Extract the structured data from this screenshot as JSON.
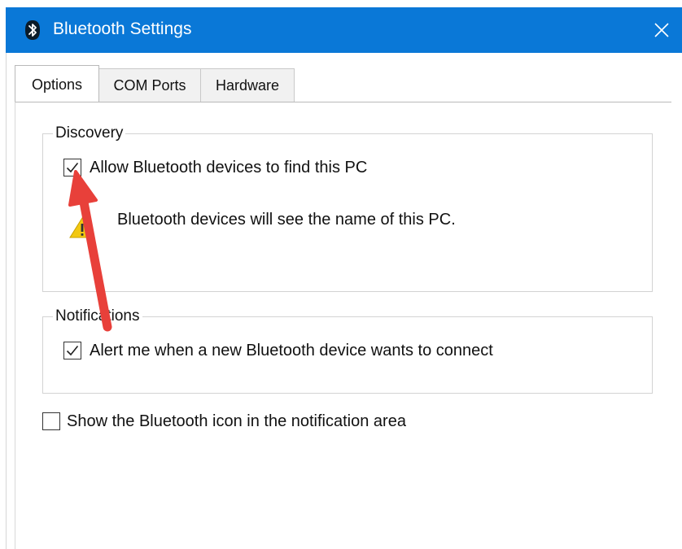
{
  "window": {
    "title": "Bluetooth Settings",
    "accent_color": "#0a78d7",
    "title_icon": "bluetooth-icon",
    "close_icon": "close-icon"
  },
  "tabs": [
    {
      "label": "Options",
      "selected": true
    },
    {
      "label": "COM Ports",
      "selected": false
    },
    {
      "label": "Hardware",
      "selected": false
    }
  ],
  "discovery": {
    "group_label": "Discovery",
    "allow_checkbox_label": "Allow Bluetooth devices to find this PC",
    "allow_checked": true,
    "warning_icon": "warning-icon",
    "warning_text": "Bluetooth devices will see the name of this PC."
  },
  "notifications": {
    "group_label": "Notifications",
    "alert_checkbox_label": "Alert me when a new Bluetooth device wants to connect",
    "alert_checked": true
  },
  "show_icon": {
    "label": "Show the Bluetooth icon in the notification area",
    "checked": false
  },
  "annotation": {
    "type": "red-arrow",
    "color": "#e8403a",
    "points_to": "allow-bluetooth-checkbox"
  }
}
